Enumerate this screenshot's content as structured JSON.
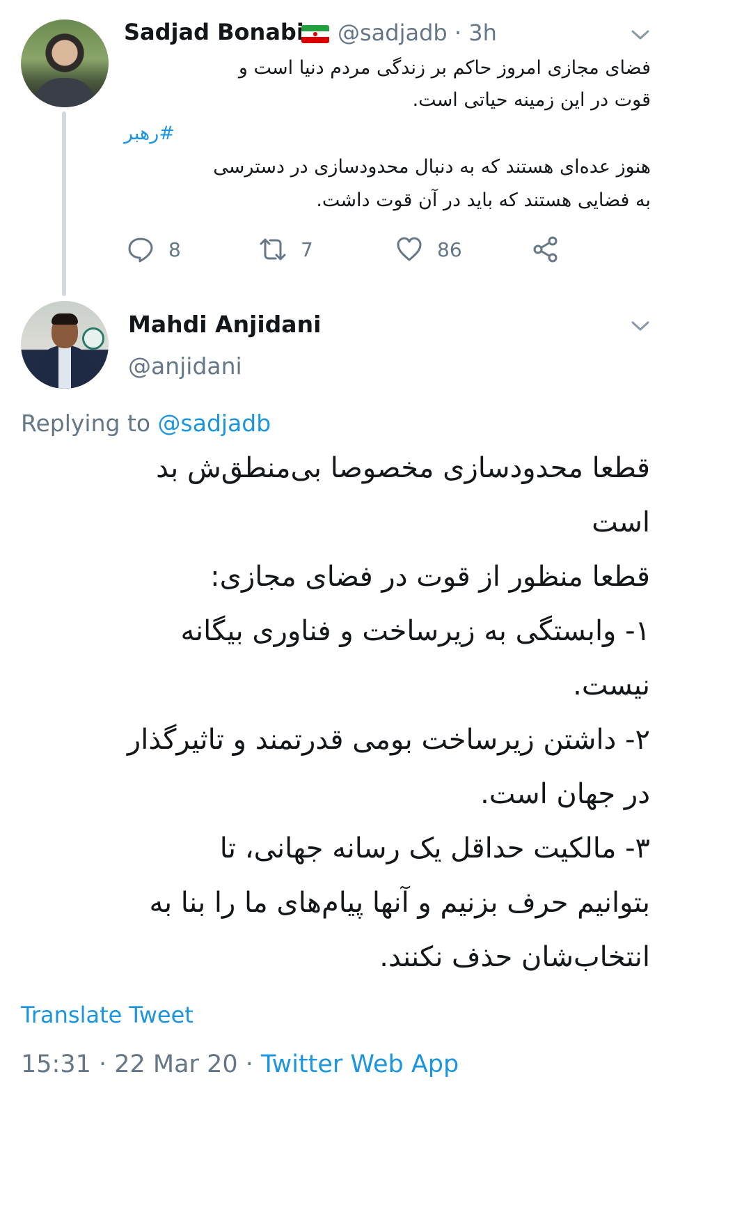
{
  "parent_tweet": {
    "author_name": "Sadjad Bonabi",
    "author_handle": "@sadjadb",
    "time_separator": "·",
    "time": "3h",
    "text_line1": "فضای مجازی امروز حاکم بر زندگی مردم دنیا است و",
    "text_line2": "قوت در این زمینه حیاتی است.",
    "hashtag": "#رهبر",
    "text_line3": "هنوز عده‌ای هستند که به دنبال محدودسازی در دسترسی",
    "text_line4": "به فضایی هستند که باید در آن قوت داشت.",
    "replies": "8",
    "retweets": "7",
    "likes": "86"
  },
  "main_tweet": {
    "author_name": "Mahdi Anjidani",
    "author_handle": "@anjidani",
    "replying_prefix": "Replying to",
    "replying_mention": "@sadjadb",
    "lines": [
      "قطعا محدودسازی مخصوصا بی‌منطق‌ش بد",
      "است",
      "قطعا منظور از قوت در فضای مجازی:",
      "۱- وابستگی به زیرساخت و فناوری بیگانه",
      "نیست.",
      "۲- داشتن زیرساخت بومی قدرتمند و تاثیرگذار",
      "در جهان است.",
      "۳- مالکیت حداقل یک رسانه جهانی، تا",
      "بتوانیم حرف بزنیم و آنها پیام‌های ما را بنا به",
      "انتخاب‌شان حذف نکنند."
    ],
    "translate_label": "Translate Tweet",
    "timestamp": "15:31 · 22 Mar 20 ·",
    "source": "Twitter Web App"
  },
  "icons": [
    "chevron-down-icon",
    "reply-icon",
    "retweet-icon",
    "like-icon",
    "share-icon",
    "iran-flag-icon"
  ],
  "colors": {
    "link_blue": "#1b95e0",
    "secondary_gray": "#657786",
    "text": "#14171a"
  }
}
